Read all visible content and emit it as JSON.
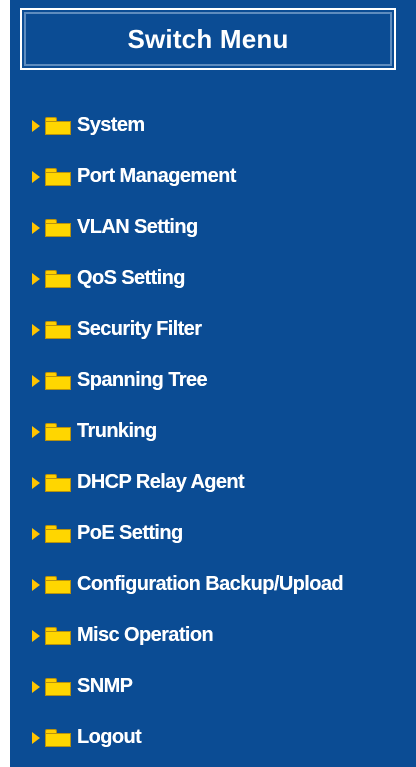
{
  "menu": {
    "title": "Switch Menu",
    "items": [
      {
        "label": "System",
        "icon": "folder-icon"
      },
      {
        "label": "Port Management",
        "icon": "folder-icon"
      },
      {
        "label": "VLAN Setting",
        "icon": "folder-icon"
      },
      {
        "label": "QoS Setting",
        "icon": "folder-icon"
      },
      {
        "label": "Security Filter",
        "icon": "folder-icon"
      },
      {
        "label": "Spanning Tree",
        "icon": "folder-icon"
      },
      {
        "label": "Trunking",
        "icon": "folder-icon"
      },
      {
        "label": "DHCP Relay Agent",
        "icon": "folder-icon"
      },
      {
        "label": "PoE Setting",
        "icon": "folder-icon"
      },
      {
        "label": "Configuration Backup/Upload",
        "icon": "folder-icon"
      },
      {
        "label": "Misc Operation",
        "icon": "folder-icon"
      },
      {
        "label": "SNMP",
        "icon": "folder-icon"
      },
      {
        "label": "Logout",
        "icon": "folder-icon"
      }
    ]
  },
  "colors": {
    "panel_background": "#0b4c94",
    "text": "#ffffff",
    "arrow": "#ffc400",
    "folder": "#ffd600"
  }
}
